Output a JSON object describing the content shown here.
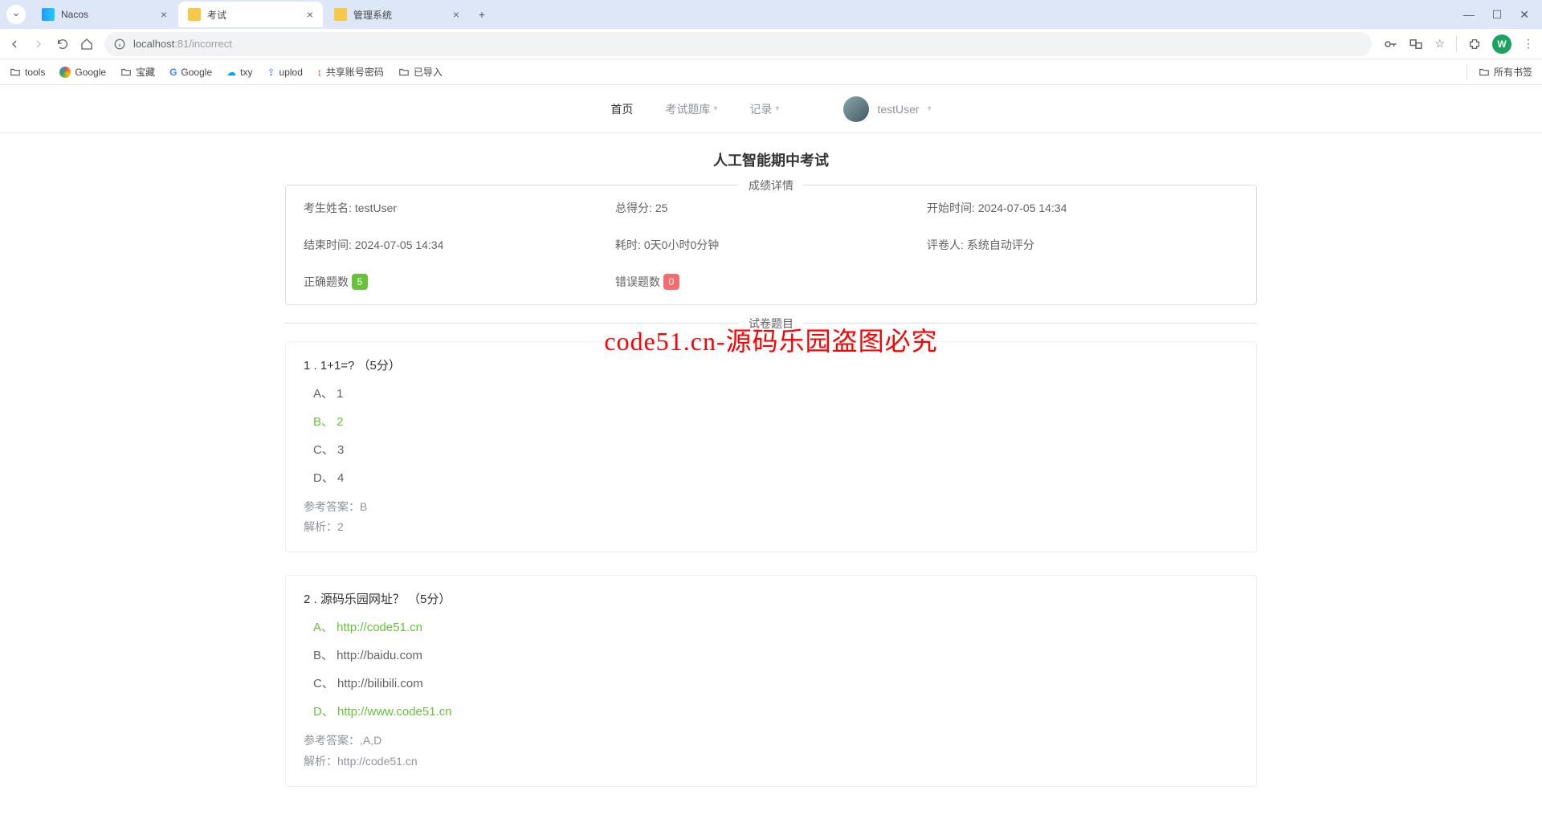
{
  "browser": {
    "tabs": [
      {
        "title": "Nacos",
        "active": false
      },
      {
        "title": "考试",
        "active": true
      },
      {
        "title": "管理系统",
        "active": false
      }
    ],
    "url_host": "localhost",
    "url_path": ":81/incorrect",
    "bookmarks": [
      "tools",
      "Google",
      "宝藏",
      "Google",
      "txy",
      "uplod",
      "共享账号密码",
      "已导入"
    ],
    "all_bookmarks": "所有书签",
    "profile_letter": "W"
  },
  "nav": {
    "home": "首页",
    "exam_bank": "考试题库",
    "records": "记录",
    "username": "testUser"
  },
  "exam": {
    "title": "人工智能期中考试",
    "score_legend": "成绩详情",
    "questions_legend": "试卷题目",
    "labels": {
      "candidate": "考生姓名:",
      "total": "总得分:",
      "start": "开始时间:",
      "end": "结束时间:",
      "duration": "耗时:",
      "grader": "评卷人:",
      "correct_count": "正确题数",
      "wrong_count": "错误题数"
    },
    "values": {
      "candidate": "testUser",
      "total": "25",
      "start": "2024-07-05 14:34",
      "end": "2024-07-05 14:34",
      "duration": "0天0小时0分钟",
      "grader": "系统自动评分",
      "correct_count": "5",
      "wrong_count": "0"
    },
    "questions": [
      {
        "number": "1",
        "text": "1+1=?",
        "points": "（5分）",
        "options": [
          {
            "key": "A、",
            "text": "1",
            "correct": false
          },
          {
            "key": "B、",
            "text": "2",
            "correct": true
          },
          {
            "key": "C、",
            "text": "3",
            "correct": false
          },
          {
            "key": "D、",
            "text": "4",
            "correct": false
          }
        ],
        "answer_label": "参考答案：",
        "answer": "B",
        "analysis_label": "解析：",
        "analysis": "2"
      },
      {
        "number": "2",
        "text": "源码乐园网址？",
        "points": "（5分）",
        "options": [
          {
            "key": "A、",
            "text": "http://code51.cn",
            "correct": true
          },
          {
            "key": "B、",
            "text": "http://baidu.com",
            "correct": false
          },
          {
            "key": "C、",
            "text": "http://bilibili.com",
            "correct": false
          },
          {
            "key": "D、",
            "text": "http://www.code51.cn",
            "correct": true
          }
        ],
        "answer_label": "参考答案：",
        "answer": ",A,D",
        "analysis_label": "解析：",
        "analysis": "http://code51.cn"
      }
    ]
  },
  "watermark": "code51.cn-源码乐园盗图必究"
}
